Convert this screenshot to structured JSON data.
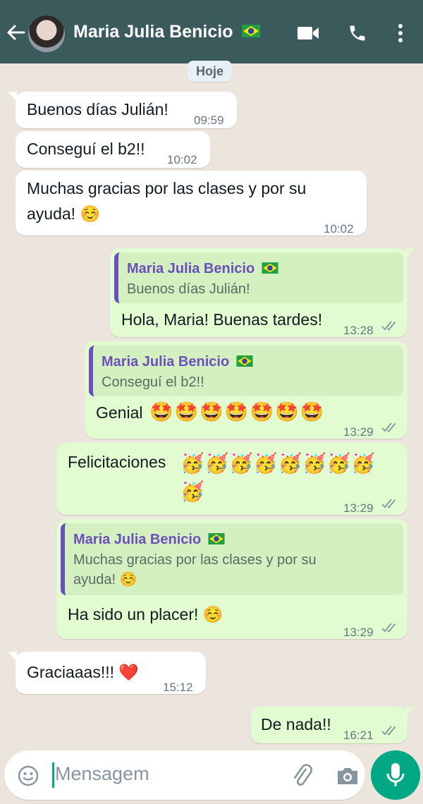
{
  "header": {
    "contact_name": "Maria Julia Benicio",
    "flag_icon": "brazil-flag-icon",
    "icons": [
      "back-arrow-icon",
      "avatar",
      "video-call-icon",
      "phone-call-icon",
      "more-options-icon"
    ]
  },
  "chat": {
    "date_chip": "Hoje",
    "messages": [
      {
        "dir": "in",
        "text": "Buenos días Julián!",
        "time": "09:59"
      },
      {
        "dir": "in",
        "text": "Conseguí el b2!!",
        "time": "10:02"
      },
      {
        "dir": "in",
        "text_line1": "Muchas gracias por las clases y por su",
        "text_line2": "ayuda! ☺️",
        "time": "10:02"
      },
      {
        "dir": "out",
        "quote_name": "Maria Julia Benicio",
        "quote_text": "Buenos días Julián!",
        "text": "Hola, Maria! Buenas tardes!",
        "time": "13:28"
      },
      {
        "dir": "out",
        "quote_name": "Maria Julia Benicio",
        "quote_text": "Conseguí el b2!!",
        "text": "Genial",
        "emoji": "🤩🤩🤩🤩🤩🤩🤩",
        "time": "13:29"
      },
      {
        "dir": "out",
        "text": "Felicitaciones",
        "emoji": "🥳🥳🥳🥳🥳🥳🥳🥳🥳",
        "time": "13:29"
      },
      {
        "dir": "out",
        "quote_name": "Maria Julia Benicio",
        "quote_text_line1": "Muchas gracias por las clases y por su",
        "quote_text_line2": "ayuda! ☺️",
        "text": "Ha sido un placer! ☺️",
        "time": "13:29"
      },
      {
        "dir": "in",
        "text": "Graciaaas!!! ❤️",
        "time": "15:12"
      },
      {
        "dir": "out",
        "text": "De nada!!",
        "time": "16:21"
      }
    ]
  },
  "input": {
    "placeholder": "Mensagem"
  },
  "colors": {
    "header": "#3a5a5c",
    "chat_bg": "#ece5dd",
    "incoming": "#ffffff",
    "outgoing": "#e2fbd0",
    "quote_accent": "#6b4fbb",
    "mic": "#00a884"
  }
}
